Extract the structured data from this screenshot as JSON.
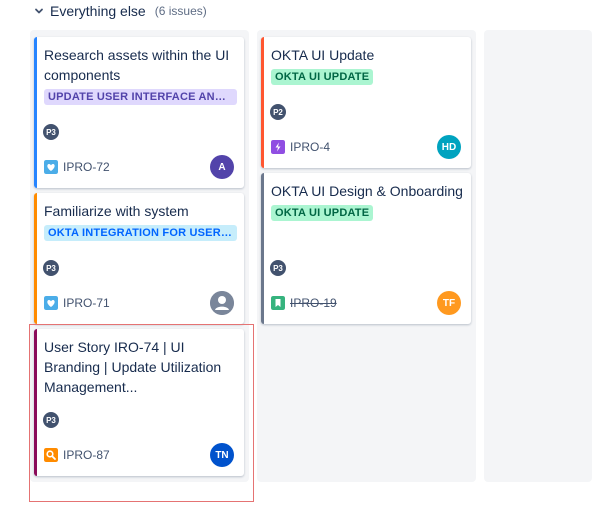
{
  "swimlane": {
    "title": "Everything else",
    "count": "(6 issues)"
  },
  "cards": [
    {
      "title": "Research assets within the UI components",
      "epic": "UPDATE USER INTERFACE AND B...",
      "priority": "P3",
      "type": "story",
      "key": "IPRO-72",
      "avatar": "A",
      "avatar_color": "#5243aa",
      "bar_color": "#2684ff",
      "done": false
    },
    {
      "title": "Familiarize with system",
      "epic": "OKTA INTEGRATION FOR USER A...",
      "priority": "P3",
      "type": "story",
      "key": "IPRO-71",
      "avatar": "",
      "avatar_color": "#7a869a",
      "bar_color": "#ff8b00",
      "done": false
    },
    {
      "title": "User Story IRO-74 | UI Branding | Update Utilization Management...",
      "epic": "",
      "priority": "P3",
      "type": "spike",
      "key": "IPRO-87",
      "avatar": "TN",
      "avatar_color": "#0052cc",
      "bar_color": "#8b0c5a",
      "done": false
    },
    {
      "title": "OKTA UI Update",
      "epic": "OKTA UI UPDATE",
      "priority": "P2",
      "type": "subtask",
      "key": "IPRO-4",
      "avatar": "HD",
      "avatar_color": "#00a3bf",
      "bar_color": "#ff5630",
      "done": false
    },
    {
      "title": "OKTA UI Design & Onboarding",
      "epic": "OKTA UI UPDATE",
      "priority": "P3",
      "type": "bookmark",
      "key": "IPRO-19",
      "avatar": "TF",
      "avatar_color": "#ff991f",
      "bar_color": "#6b778c",
      "done": true
    }
  ],
  "colors": {
    "epic_purple_bg": "#dfd8fd",
    "epic_purple_fg": "#5243aa",
    "epic_blue_bg": "#c6edfb",
    "epic_blue_fg": "#0065ff",
    "epic_green_bg": "#abf5d1",
    "epic_green_fg": "#006644",
    "highlight": "#e57373"
  }
}
